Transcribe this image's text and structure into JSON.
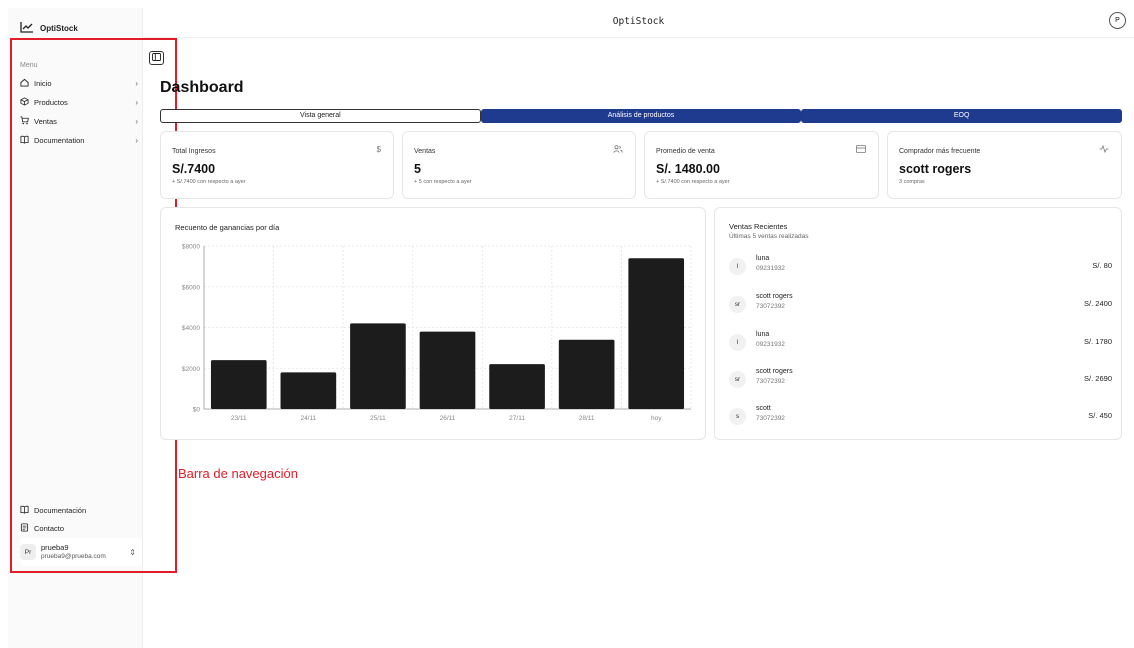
{
  "app": {
    "brand": "OptiStock",
    "header_title": "OptiStock",
    "profile_initial": "P"
  },
  "sidebar": {
    "menu_title": "Menu",
    "items": [
      {
        "label": "Inicio",
        "icon": "home-icon"
      },
      {
        "label": "Productos",
        "icon": "package-icon"
      },
      {
        "label": "Ventas",
        "icon": "cart-icon"
      },
      {
        "label": "Documentation",
        "icon": "book-icon"
      }
    ],
    "bottom": [
      {
        "label": "Documentación",
        "icon": "book-icon"
      },
      {
        "label": "Contacto",
        "icon": "contact-icon"
      }
    ],
    "user": {
      "initials": "Pr",
      "name": "prueba9",
      "email": "prueba9@prueba.com"
    }
  },
  "annotation": {
    "label": "Barra de navegación",
    "color": "#e11d2a"
  },
  "page": {
    "title": "Dashboard"
  },
  "tabs": [
    {
      "label": "Vista general",
      "active": true
    },
    {
      "label": "Análisis de productos",
      "active": false
    },
    {
      "label": "EOQ",
      "active": false
    }
  ],
  "stats": [
    {
      "label": "Total Ingresos",
      "icon": "dollar-icon",
      "value": "S/.7400",
      "sub": "+ S/.7400 con respecto a ayer"
    },
    {
      "label": "Ventas",
      "icon": "users-icon",
      "value": "5",
      "sub": "+ 5 con respecto a ayer"
    },
    {
      "label": "Promedio de venta",
      "icon": "card-icon",
      "value": "S/. 1480.00",
      "sub": "+ S/.7400 con respecto a ayer"
    },
    {
      "label": "Comprador más frecuente",
      "icon": "activity-icon",
      "value": "scott rogers",
      "sub": "3 compras"
    }
  ],
  "chart_data": {
    "type": "bar",
    "title": "Recuento de ganancias por día",
    "categories": [
      "23/11",
      "24/11",
      "25/11",
      "26/11",
      "27/11",
      "28/11",
      "hoy"
    ],
    "values": [
      2400,
      1800,
      4200,
      3800,
      2200,
      3400,
      7400
    ],
    "ylim": [
      0,
      8000
    ],
    "yticks": [
      "$0",
      "$2000",
      "$4000",
      "$6000",
      "$8000"
    ],
    "grid": true,
    "bar_color": "#1c1c1c"
  },
  "recent": {
    "title": "Ventas Recientes",
    "subtitle": "Últimas 5 ventas realizadas",
    "items": [
      {
        "initials": "l",
        "name": "luna",
        "code": "09231932",
        "amount": "S/. 80"
      },
      {
        "initials": "sr",
        "name": "scott rogers",
        "code": "73072392",
        "amount": "S/. 2400"
      },
      {
        "initials": "l",
        "name": "luna",
        "code": "09231932",
        "amount": "S/. 1780"
      },
      {
        "initials": "sr",
        "name": "scott rogers",
        "code": "73072392",
        "amount": "S/. 2690"
      },
      {
        "initials": "s",
        "name": "scott",
        "code": "73072392",
        "amount": "S/. 450"
      }
    ]
  }
}
